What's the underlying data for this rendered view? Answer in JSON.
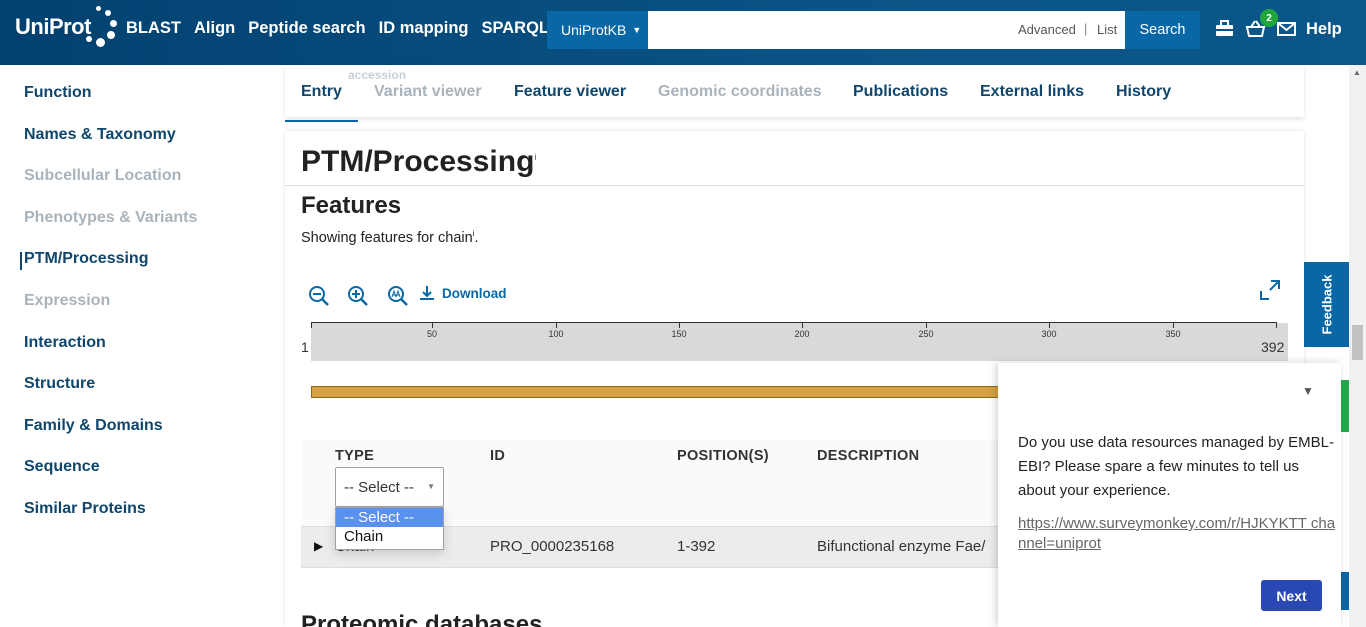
{
  "header": {
    "logo": "UniProt",
    "nav": [
      "BLAST",
      "Align",
      "Peptide search",
      "ID mapping",
      "SPARQL"
    ],
    "database": "UniProtKB",
    "search_value": "",
    "advanced": "Advanced",
    "separator": "|",
    "list": "List",
    "search_button": "Search",
    "basket_count": "2",
    "help": "Help"
  },
  "sidebar": {
    "items": [
      {
        "label": "Function"
      },
      {
        "label": "Names & Taxonomy"
      },
      {
        "label": "Subcellular Location"
      },
      {
        "label": "Phenotypes & Variants"
      },
      {
        "label": "PTM/Processing"
      },
      {
        "label": "Expression"
      },
      {
        "label": "Interaction"
      },
      {
        "label": "Structure"
      },
      {
        "label": "Family & Domains"
      },
      {
        "label": "Sequence"
      },
      {
        "label": "Similar Proteins"
      }
    ]
  },
  "tabs": {
    "ghost": "accession",
    "items": [
      {
        "label": "Entry"
      },
      {
        "label": "Variant viewer"
      },
      {
        "label": "Feature viewer"
      },
      {
        "label": "Genomic coordinates"
      },
      {
        "label": "Publications"
      },
      {
        "label": "External links"
      },
      {
        "label": "History"
      }
    ]
  },
  "section": {
    "title": "PTM/Processing",
    "info_marker": "i",
    "features_title": "Features",
    "features_sub": "Showing features for chain",
    "features_sub_end": "."
  },
  "viewer": {
    "download": "Download",
    "range_start": "1",
    "range_end": "392",
    "ticks": [
      "50",
      "100",
      "150",
      "200",
      "250",
      "300",
      "350"
    ]
  },
  "table": {
    "headers": [
      "TYPE",
      "ID",
      "POSITION(S)",
      "DESCRIPTION"
    ],
    "type_filter_value": "-- Select --",
    "dropdown_options": [
      "-- Select --",
      "Chain"
    ],
    "rows": [
      {
        "type": "Chain",
        "id": "PRO_0000235168",
        "position": "1-392",
        "description": "Bifunctional enzyme Fae/"
      }
    ]
  },
  "next_section": "Proteomic databases",
  "feedback": "Feedback",
  "survey": {
    "question": "Do you use data resources managed by EMBL-EBI? Please spare a few minutes to tell us about your experience.",
    "link": "https://www.surveymonkey.com/r/HJKYKTT channel=uniprot",
    "next": "Next"
  }
}
